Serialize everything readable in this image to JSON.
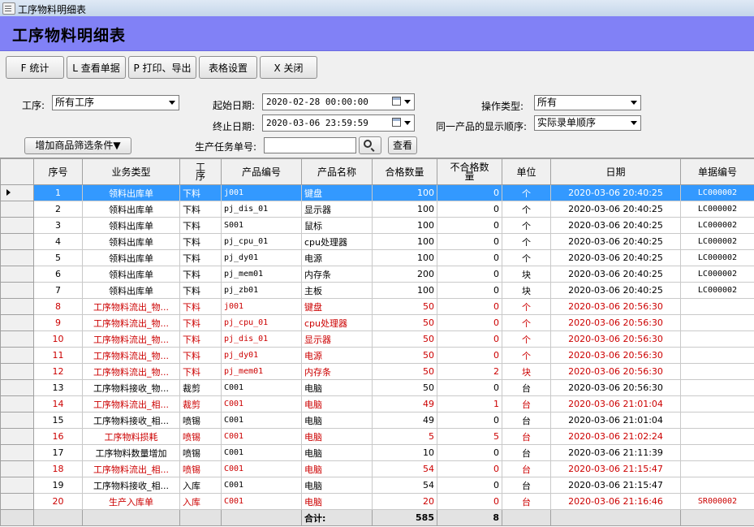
{
  "window": {
    "title": "工序物料明细表"
  },
  "header": {
    "title": "工序物料明细表"
  },
  "toolbar": {
    "stats": "F 统计",
    "view_doc": "L 查看单据",
    "print_export": "P 打印、导出",
    "table_settings": "表格设置",
    "close": "X 关闭"
  },
  "filters": {
    "process_label": "工序:",
    "process_value": "所有工序",
    "start_date_label": "起始日期:",
    "start_date_value": "2020-02-28 00:00:00",
    "end_date_label": "终止日期:",
    "end_date_value": "2020-03-06 23:59:59",
    "op_type_label": "操作类型:",
    "op_type_value": "所有",
    "order_label": "同一产品的显示顺序:",
    "order_value": "实际录单顺序",
    "add_filter": "增加商品筛选条件▼",
    "task_label": "生产任务单号:",
    "task_value": "",
    "search_button": "查看"
  },
  "table": {
    "columns": [
      "序号",
      "业务类型",
      "工序",
      "产品编号",
      "产品名称",
      "合格数量",
      "不合格数量",
      "单位",
      "日期",
      "单据编号"
    ],
    "rows": [
      {
        "no": "1",
        "type": "领料出库单",
        "proc": "下料",
        "code": "j001",
        "name": "键盘",
        "ok": "100",
        "bad": "0",
        "unit": "个",
        "date": "2020-03-06 20:40:25",
        "doc": "LC000002",
        "red": false,
        "sel": true
      },
      {
        "no": "2",
        "type": "领料出库单",
        "proc": "下料",
        "code": "pj_dis_01",
        "name": "显示器",
        "ok": "100",
        "bad": "0",
        "unit": "个",
        "date": "2020-03-06 20:40:25",
        "doc": "LC000002",
        "red": false,
        "sel": false
      },
      {
        "no": "3",
        "type": "领料出库单",
        "proc": "下料",
        "code": "S001",
        "name": "鼠标",
        "ok": "100",
        "bad": "0",
        "unit": "个",
        "date": "2020-03-06 20:40:25",
        "doc": "LC000002",
        "red": false,
        "sel": false
      },
      {
        "no": "4",
        "type": "领料出库单",
        "proc": "下料",
        "code": "pj_cpu_01",
        "name": "cpu处理器",
        "ok": "100",
        "bad": "0",
        "unit": "个",
        "date": "2020-03-06 20:40:25",
        "doc": "LC000002",
        "red": false,
        "sel": false
      },
      {
        "no": "5",
        "type": "领料出库单",
        "proc": "下料",
        "code": "pj_dy01",
        "name": "电源",
        "ok": "100",
        "bad": "0",
        "unit": "个",
        "date": "2020-03-06 20:40:25",
        "doc": "LC000002",
        "red": false,
        "sel": false
      },
      {
        "no": "6",
        "type": "领料出库单",
        "proc": "下料",
        "code": "pj_mem01",
        "name": "内存条",
        "ok": "200",
        "bad": "0",
        "unit": "块",
        "date": "2020-03-06 20:40:25",
        "doc": "LC000002",
        "red": false,
        "sel": false
      },
      {
        "no": "7",
        "type": "领料出库单",
        "proc": "下料",
        "code": "pj_zb01",
        "name": "主板",
        "ok": "100",
        "bad": "0",
        "unit": "块",
        "date": "2020-03-06 20:40:25",
        "doc": "LC000002",
        "red": false,
        "sel": false
      },
      {
        "no": "8",
        "type": "工序物料流出_物...",
        "proc": "下料",
        "code": "j001",
        "name": "键盘",
        "ok": "50",
        "bad": "0",
        "unit": "个",
        "date": "2020-03-06 20:56:30",
        "doc": "",
        "red": true,
        "sel": false
      },
      {
        "no": "9",
        "type": "工序物料流出_物...",
        "proc": "下料",
        "code": "pj_cpu_01",
        "name": "cpu处理器",
        "ok": "50",
        "bad": "0",
        "unit": "个",
        "date": "2020-03-06 20:56:30",
        "doc": "",
        "red": true,
        "sel": false
      },
      {
        "no": "10",
        "type": "工序物料流出_物...",
        "proc": "下料",
        "code": "pj_dis_01",
        "name": "显示器",
        "ok": "50",
        "bad": "0",
        "unit": "个",
        "date": "2020-03-06 20:56:30",
        "doc": "",
        "red": true,
        "sel": false
      },
      {
        "no": "11",
        "type": "工序物料流出_物...",
        "proc": "下料",
        "code": "pj_dy01",
        "name": "电源",
        "ok": "50",
        "bad": "0",
        "unit": "个",
        "date": "2020-03-06 20:56:30",
        "doc": "",
        "red": true,
        "sel": false
      },
      {
        "no": "12",
        "type": "工序物料流出_物...",
        "proc": "下料",
        "code": "pj_mem01",
        "name": "内存条",
        "ok": "50",
        "bad": "2",
        "unit": "块",
        "date": "2020-03-06 20:56:30",
        "doc": "",
        "red": true,
        "sel": false
      },
      {
        "no": "13",
        "type": "工序物料接收_物...",
        "proc": "裁剪",
        "code": "C001",
        "name": "电脑",
        "ok": "50",
        "bad": "0",
        "unit": "台",
        "date": "2020-03-06 20:56:30",
        "doc": "",
        "red": false,
        "sel": false
      },
      {
        "no": "14",
        "type": "工序物料流出_相...",
        "proc": "裁剪",
        "code": "C001",
        "name": "电脑",
        "ok": "49",
        "bad": "1",
        "unit": "台",
        "date": "2020-03-06 21:01:04",
        "doc": "",
        "red": true,
        "sel": false
      },
      {
        "no": "15",
        "type": "工序物料接收_相...",
        "proc": "喷锡",
        "code": "C001",
        "name": "电脑",
        "ok": "49",
        "bad": "0",
        "unit": "台",
        "date": "2020-03-06 21:01:04",
        "doc": "",
        "red": false,
        "sel": false
      },
      {
        "no": "16",
        "type": "工序物料损耗",
        "proc": "喷锡",
        "code": "C001",
        "name": "电脑",
        "ok": "5",
        "bad": "5",
        "unit": "台",
        "date": "2020-03-06 21:02:24",
        "doc": "",
        "red": true,
        "sel": false
      },
      {
        "no": "17",
        "type": "工序物料数量增加",
        "proc": "喷锡",
        "code": "C001",
        "name": "电脑",
        "ok": "10",
        "bad": "0",
        "unit": "台",
        "date": "2020-03-06 21:11:39",
        "doc": "",
        "red": false,
        "sel": false
      },
      {
        "no": "18",
        "type": "工序物料流出_相...",
        "proc": "喷锡",
        "code": "C001",
        "name": "电脑",
        "ok": "54",
        "bad": "0",
        "unit": "台",
        "date": "2020-03-06 21:15:47",
        "doc": "",
        "red": true,
        "sel": false
      },
      {
        "no": "19",
        "type": "工序物料接收_相...",
        "proc": "入库",
        "code": "C001",
        "name": "电脑",
        "ok": "54",
        "bad": "0",
        "unit": "台",
        "date": "2020-03-06 21:15:47",
        "doc": "",
        "red": false,
        "sel": false
      },
      {
        "no": "20",
        "type": "生产入库单",
        "proc": "入库",
        "code": "C001",
        "name": "电脑",
        "ok": "20",
        "bad": "0",
        "unit": "台",
        "date": "2020-03-06 21:16:46",
        "doc": "SR000002",
        "red": true,
        "sel": false
      }
    ],
    "footer": {
      "label": "合计:",
      "ok_total": "585",
      "bad_total": "8"
    }
  }
}
